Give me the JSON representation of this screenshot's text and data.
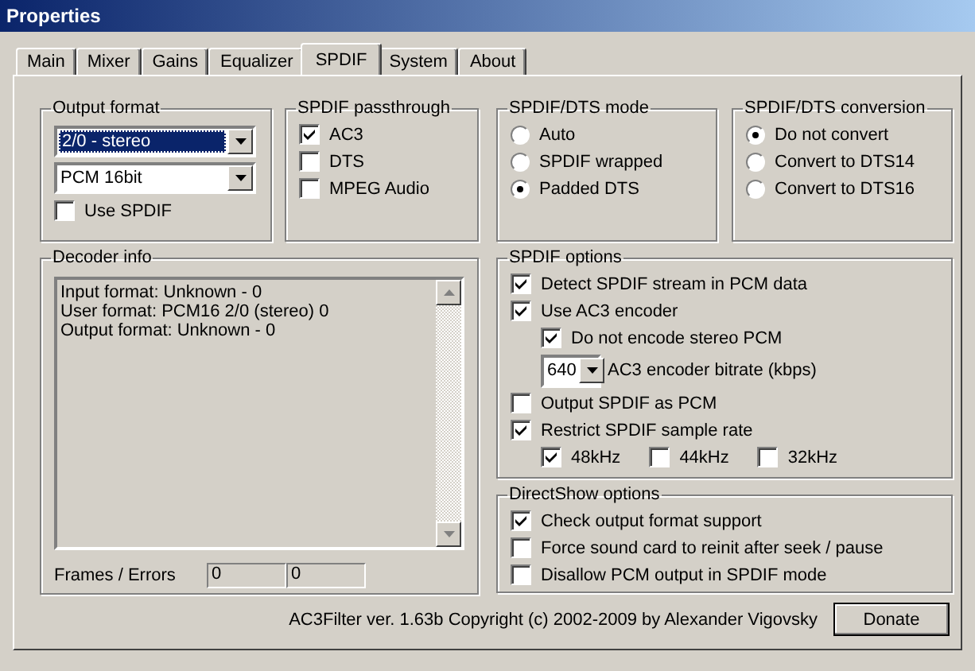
{
  "window": {
    "title": "Properties"
  },
  "tabs": [
    {
      "label": "Main",
      "selected": false
    },
    {
      "label": "Mixer",
      "selected": false
    },
    {
      "label": "Gains",
      "selected": false
    },
    {
      "label": "Equalizer",
      "selected": false
    },
    {
      "label": "SPDIF",
      "selected": true
    },
    {
      "label": "System",
      "selected": false
    },
    {
      "label": "About",
      "selected": false
    }
  ],
  "output_format": {
    "title": "Output format",
    "dropdowns": [
      {
        "value": "2/0 - stereo",
        "focused": true
      },
      {
        "value": "PCM 16bit",
        "focused": false
      }
    ],
    "use_spdif": {
      "label": "Use SPDIF",
      "checked": false
    }
  },
  "spdif_passthrough": {
    "title": "SPDIF passthrough",
    "options": [
      {
        "label": "AC3",
        "checked": true
      },
      {
        "label": "DTS",
        "checked": false
      },
      {
        "label": "MPEG Audio",
        "checked": false
      }
    ]
  },
  "spdif_dts_mode": {
    "title": "SPDIF/DTS mode",
    "options": [
      {
        "label": "Auto",
        "selected": false
      },
      {
        "label": "SPDIF wrapped",
        "selected": false
      },
      {
        "label": "Padded DTS",
        "selected": true
      }
    ]
  },
  "spdif_dts_conversion": {
    "title": "SPDIF/DTS conversion",
    "options": [
      {
        "label": "Do not convert",
        "selected": true
      },
      {
        "label": "Convert to DTS14",
        "selected": false
      },
      {
        "label": "Convert to DTS16",
        "selected": false
      }
    ]
  },
  "decoder_info": {
    "title": "Decoder info",
    "lines": [
      "Input format: Unknown - 0",
      "User format: PCM16 2/0 (stereo) 0",
      "Output format: Unknown - 0"
    ],
    "frames_label": "Frames / Errors",
    "frames": "0",
    "errors": "0"
  },
  "spdif_options": {
    "title": "SPDIF options",
    "items": [
      {
        "kind": "checkbox",
        "label": "Detect SPDIF stream in PCM data",
        "checked": true
      },
      {
        "kind": "checkbox",
        "label": "Use AC3 encoder",
        "checked": true,
        "children": [
          {
            "kind": "checkbox",
            "label": "Do not encode stereo PCM",
            "checked": true
          },
          {
            "kind": "dropdown",
            "value": "640",
            "label": "AC3 encoder bitrate (kbps)"
          }
        ]
      },
      {
        "kind": "checkbox",
        "label": "Output SPDIF as PCM",
        "checked": false
      },
      {
        "kind": "checkbox",
        "label": "Restrict SPDIF sample rate",
        "checked": true,
        "children": [
          {
            "kind": "rate",
            "label": "48kHz",
            "checked": true
          },
          {
            "kind": "rate",
            "label": "44kHz",
            "checked": false
          },
          {
            "kind": "rate",
            "label": "32kHz",
            "checked": false
          }
        ]
      }
    ]
  },
  "directshow_options": {
    "title": "DirectShow options",
    "items": [
      {
        "label": "Check output format support",
        "checked": true
      },
      {
        "label": "Force sound card to reinit after seek / pause",
        "checked": false
      },
      {
        "label": "Disallow PCM output in SPDIF mode",
        "checked": false
      }
    ]
  },
  "footer": {
    "copyright": "AC3Filter ver. 1.63b Copyright (c) 2002-2009 by Alexander Vigovsky",
    "button": "Donate"
  }
}
